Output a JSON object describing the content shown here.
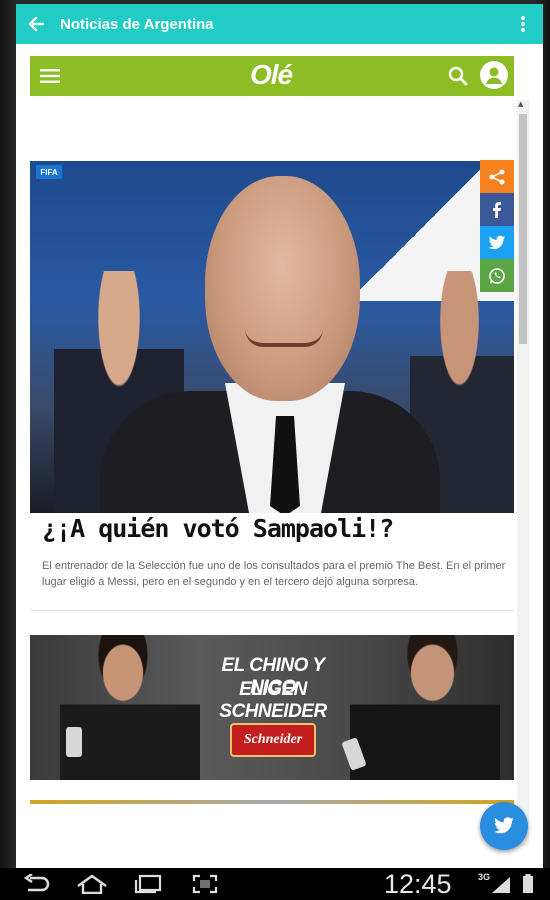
{
  "app_bar": {
    "title": "Noticias de Argentina",
    "accent_color": "#22ccc6",
    "back_icon": "arrow-left-icon",
    "menu_icon": "more-vert-icon"
  },
  "site_header": {
    "logo_text": "Olé",
    "brand_color": "#8cbd24",
    "menu_icon": "hamburger-icon",
    "search_icon": "search-icon",
    "account_icon": "user-icon"
  },
  "article": {
    "photo_badge": "FIFA",
    "headline": "¿¡A quién votó Sampaoli!?",
    "summary": "El entrenador de la Selección fue uno de los consultados para el premio The Best. En el primer lugar eligió a Messi, pero en el segundo y en el tercero dejó alguna sorpresa."
  },
  "share_buttons": [
    {
      "name": "share",
      "color": "#f5821f"
    },
    {
      "name": "facebook",
      "color": "#3b5998"
    },
    {
      "name": "twitter",
      "color": "#1da1f2"
    },
    {
      "name": "whatsapp",
      "color": "#5aa544"
    }
  ],
  "ad": {
    "line1": "EL CHINO Y NICO",
    "line2": "ELIGEN SCHNEIDER",
    "brand": "Schneider"
  },
  "fab": {
    "icon": "twitter-icon",
    "color": "#2a8ee0"
  },
  "system_bar": {
    "time": "12:45",
    "network": "3G",
    "nav_icons": [
      "back-icon",
      "home-icon",
      "recents-icon",
      "screenshot-icon"
    ]
  }
}
